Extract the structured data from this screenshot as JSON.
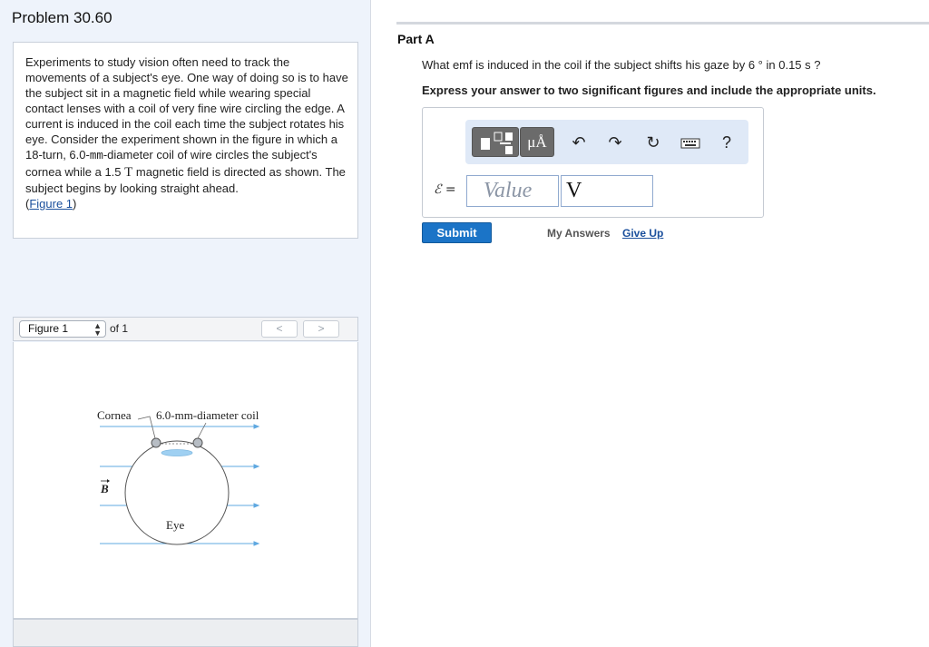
{
  "problem": {
    "title": "Problem 30.60",
    "text_part1": "Experiments to study vision often need to track the movements of a subject's eye. One way of doing so is to have the subject sit in a magnetic field while wearing special contact lenses with a coil of very fine wire circling the edge. A current is induced in the coil each time the subject rotates his eye. Consider the experiment shown in the figure in which a 18-turn, 6.0-",
    "unit_mm": "mm",
    "text_part2": "-diameter coil of wire circles the subject's cornea while a 1.5 ",
    "unit_T": "T",
    "text_part3": " magnetic field is directed as shown. The subject begins by looking straight ahead.",
    "figure_link_open": "(",
    "figure_link": "Figure 1",
    "figure_link_close": ")"
  },
  "figure_viewer": {
    "selected": "Figure 1",
    "of_label": "of 1",
    "prev_label": "<",
    "next_label": ">",
    "labels": {
      "cornea": "Cornea",
      "coil": "6.0-mm-diameter coil",
      "field": "B",
      "eye": "Eye"
    }
  },
  "part": {
    "title": "Part A",
    "question": "What emf is induced in the coil if the subject shifts his gaze by 6 ° in 0.15 s ?",
    "instruction": "Express your answer to two significant figures and include the appropriate units.",
    "toolbar": {
      "units_label": "μÅ",
      "undo_icon": "↶",
      "redo_icon": "↷",
      "reset_icon": "↻",
      "help_label": "?"
    },
    "answer_label": "ℰ =",
    "value_placeholder": "Value",
    "units_value": "V",
    "submit_label": "Submit",
    "my_answers_label": "My Answers",
    "give_up_label": "Give Up"
  },
  "colors": {
    "accent": "#1b74c7",
    "link": "#1a4f9c",
    "left_pane_bg": "#eef3fb",
    "field_lines": "#5fa8e0"
  }
}
